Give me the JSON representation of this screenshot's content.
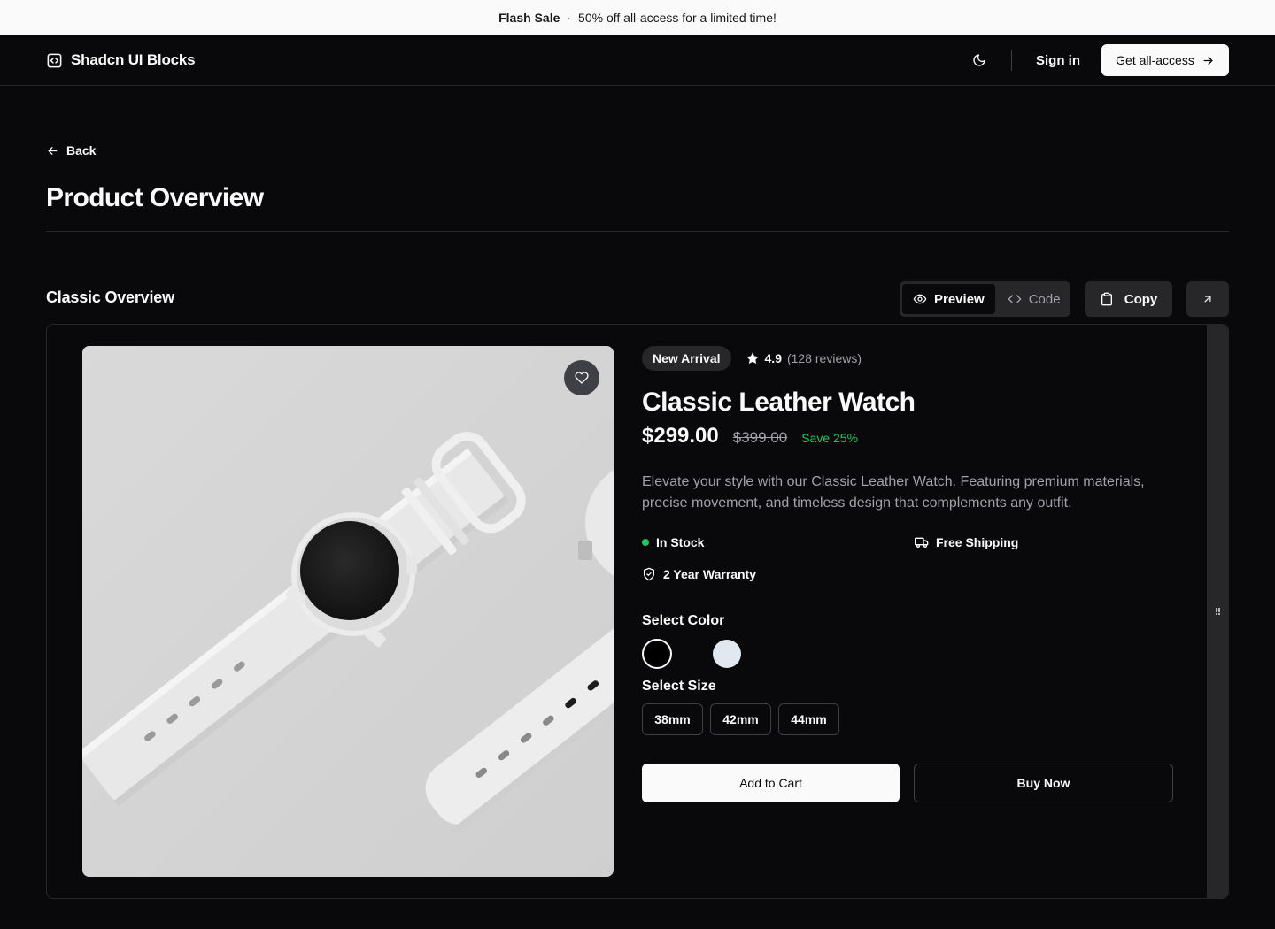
{
  "banner": {
    "sale_label": "Flash Sale",
    "separator": "·",
    "message": "50% off all-access for a limited time!"
  },
  "header": {
    "brand": "Shadcn UI Blocks",
    "theme_icon": "moon-icon",
    "sign_in": "Sign in",
    "cta": "Get all-access"
  },
  "page": {
    "back": "Back",
    "title": "Product Overview"
  },
  "section": {
    "title": "Classic Overview",
    "tabs": [
      {
        "label": "Preview",
        "icon": "eye-icon"
      },
      {
        "label": "Code",
        "icon": "code-icon"
      }
    ],
    "active_tab": "Preview",
    "copy": "Copy"
  },
  "product": {
    "badge": "New Arrival",
    "rating": "4.9",
    "reviews": "(128 reviews)",
    "name": "Classic Leather Watch",
    "price": "$299.00",
    "old_price": "$399.00",
    "save": "Save 25%",
    "description": "Elevate your style with our Classic Leather Watch. Featuring premium materials, precise movement, and timeless design that complements any outfit.",
    "features": {
      "stock": "In Stock",
      "shipping": "Free Shipping",
      "warranty": "2 Year Warranty"
    },
    "color_label": "Select Color",
    "colors": [
      "#000000",
      "#e2e8f0"
    ],
    "size_label": "Select Size",
    "sizes": [
      "38mm",
      "42mm",
      "44mm"
    ],
    "add_to_cart": "Add to Cart",
    "buy_now": "Buy Now"
  },
  "colors": {
    "background": "#09090b",
    "surface": "#27272a",
    "accent_green": "#22c55e",
    "text": "#fafafa",
    "muted": "#a1a1aa"
  }
}
